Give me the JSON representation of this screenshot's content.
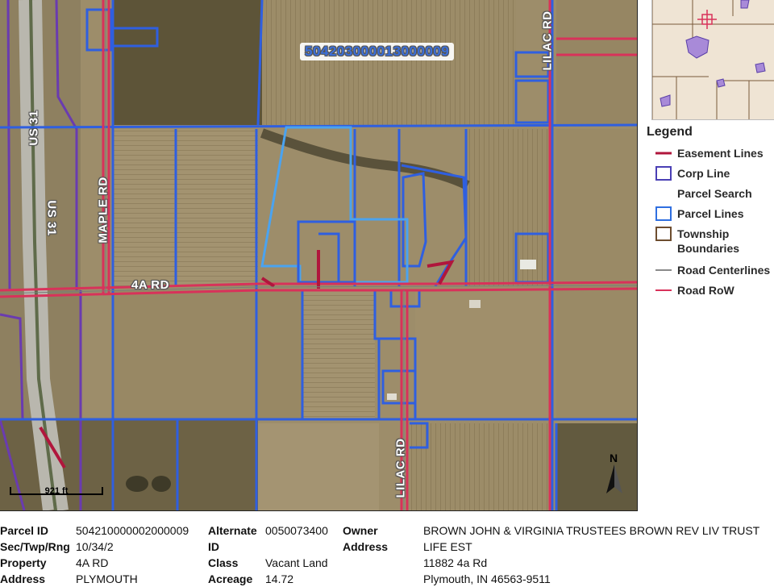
{
  "map": {
    "parcel_label": "504203000013000009",
    "roads": {
      "us31_a": "US 31",
      "us31_b": "US 31",
      "maple": "MAPLE RD",
      "fourA": "4A RD",
      "lilac_top": "LILAC RD",
      "lilac_bottom": "LILAC RD"
    },
    "scale": "921 ft",
    "north": "N",
    "colors": {
      "parcel": "#2f5fe0",
      "corp": "#6a3bb0",
      "row": "#d8325a",
      "easement": "#b0163c",
      "township": "#7a5a3a",
      "centerline": "#7b7b7b",
      "field": "#9a8a66"
    }
  },
  "legend": {
    "title": "Legend",
    "items": [
      {
        "label": "Easement Lines",
        "symbol": "line",
        "color": "#b0163c"
      },
      {
        "label": "Corp Line",
        "symbol": "box",
        "color": "#4a3fb5"
      },
      {
        "label": "Parcel Search",
        "symbol": "none",
        "color": ""
      },
      {
        "label": "Parcel Lines",
        "symbol": "box",
        "color": "#2f6fe0"
      },
      {
        "label": "Township Boundaries",
        "symbol": "box",
        "color": "#6d4d2f"
      },
      {
        "label": "Road Centerlines",
        "symbol": "line",
        "color": "#8a8a8a"
      },
      {
        "label": "Road RoW",
        "symbol": "line",
        "color": "#d8325a"
      }
    ]
  },
  "info": {
    "parcel_id_label": "Parcel ID",
    "parcel_id_value": "504210000002000009",
    "stc_label": "Sec/Twp/Rng",
    "stc_value": "10/34/2",
    "property_label": "Property",
    "property_value": "4A RD",
    "address_label": "Address",
    "address_value": "PLYMOUTH",
    "alt_label_1": "Alternate",
    "alt_label_2": "ID",
    "alt_value": "0050073400",
    "class_label": "Class",
    "class_value": "Vacant Land",
    "acreage_label": "Acreage",
    "acreage_value": "14.72",
    "owner_label_1": "Owner",
    "owner_label_2": "Address",
    "owner_line1": "BROWN JOHN & VIRGINIA TRUSTEES BROWN REV LIV TRUST",
    "owner_line2": "LIFE EST",
    "owner_line3": "11882 4a Rd",
    "owner_line4": "Plymouth, IN 46563-9511"
  }
}
